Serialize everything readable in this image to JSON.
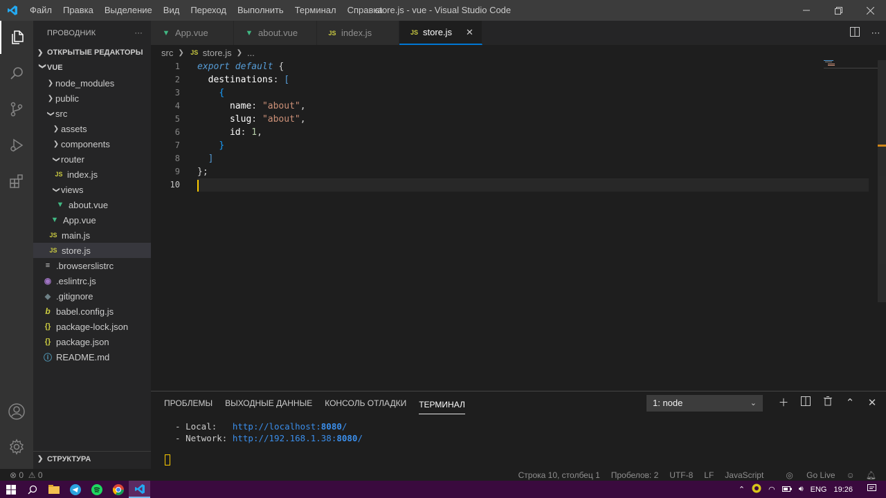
{
  "window": {
    "title": "store.js - vue - Visual Studio Code",
    "menu": [
      "Файл",
      "Правка",
      "Выделение",
      "Вид",
      "Переход",
      "Выполнить",
      "Терминал",
      "Справка"
    ]
  },
  "activity_bar": {
    "icons": [
      "explorer-icon",
      "search-icon",
      "source-control-icon",
      "run-debug-icon",
      "extensions-icon",
      "account-icon",
      "settings-gear-icon"
    ]
  },
  "sidebar": {
    "title": "ПРОВОДНИК",
    "more": "···",
    "open_editors": "ОТКРЫТЫЕ РЕДАКТОРЫ",
    "project": "VUE",
    "outline": "СТРУКТУРА",
    "tree": [
      {
        "label": "node_modules",
        "type": "folder",
        "expanded": false
      },
      {
        "label": "public",
        "type": "folder",
        "expanded": false
      },
      {
        "label": "src",
        "type": "folder",
        "expanded": true
      },
      {
        "label": "assets",
        "type": "folder",
        "expanded": false
      },
      {
        "label": "components",
        "type": "folder",
        "expanded": false
      },
      {
        "label": "router",
        "type": "folder",
        "expanded": true
      },
      {
        "label": "index.js",
        "type": "js"
      },
      {
        "label": "views",
        "type": "folder",
        "expanded": true
      },
      {
        "label": "about.vue",
        "type": "vue"
      },
      {
        "label": "App.vue",
        "type": "vue"
      },
      {
        "label": "main.js",
        "type": "js"
      },
      {
        "label": "store.js",
        "type": "js",
        "selected": true
      },
      {
        "label": ".browserslistrc",
        "type": "lines"
      },
      {
        "label": ".eslintrc.js",
        "type": "eslint"
      },
      {
        "label": ".gitignore",
        "type": "git"
      },
      {
        "label": "babel.config.js",
        "type": "babel"
      },
      {
        "label": "package-lock.json",
        "type": "json"
      },
      {
        "label": "package.json",
        "type": "json"
      },
      {
        "label": "README.md",
        "type": "info"
      }
    ]
  },
  "tabs": [
    {
      "label": "App.vue",
      "type": "vue"
    },
    {
      "label": "about.vue",
      "type": "vue"
    },
    {
      "label": "index.js",
      "type": "js"
    },
    {
      "label": "store.js",
      "type": "js",
      "active": true
    }
  ],
  "breadcrumb": {
    "folder": "src",
    "file": "store.js",
    "rest": "..."
  },
  "editor": {
    "line_numbers": [
      "1",
      "2",
      "3",
      "4",
      "5",
      "6",
      "7",
      "8",
      "9",
      "10"
    ],
    "code": {
      "l1_kw": "export default",
      "l2_prop": "destinations",
      "l4_prop": "name",
      "l4_val": "\"about\"",
      "l5_prop": "slug",
      "l5_val": "\"about\"",
      "l6_prop": "id",
      "l6_val": "1"
    }
  },
  "panel": {
    "tabs": [
      "ПРОБЛЕМЫ",
      "ВЫХОДНЫЕ ДАННЫЕ",
      "КОНСОЛЬ ОТЛАДКИ",
      "ТЕРМИНАЛ"
    ],
    "active_tab": "ТЕРМИНАЛ",
    "terminal_select": "1: node",
    "lines": [
      {
        "label": "  - Local:   ",
        "url": "http://localhost:",
        "port": "8080",
        "tail": "/"
      },
      {
        "label": "  - Network: ",
        "url": "http://192.168.1.38:",
        "port": "8080",
        "tail": "/"
      }
    ]
  },
  "status": {
    "errors": "0",
    "warnings": "0",
    "position": "Строка 10, столбец 1",
    "spaces": "Пробелов: 2",
    "encoding": "UTF-8",
    "eol": "LF",
    "language": "JavaScript",
    "golive": "Go Live"
  },
  "taskbar": {
    "lang": "ENG",
    "time": "19:26"
  },
  "colors": {
    "accent": "#0078d4",
    "titlebar": "#3c3c3c",
    "taskbar": "#3a0a3e"
  }
}
